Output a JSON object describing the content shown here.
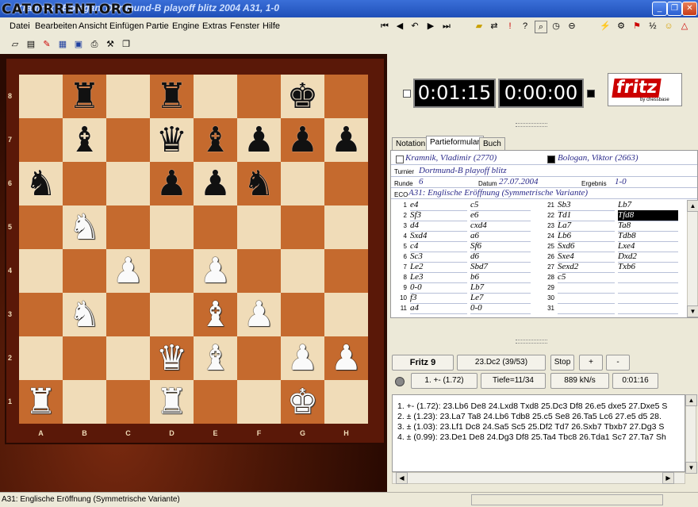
{
  "window": {
    "watermark": "CATORRENT.ORG",
    "title": "Kramnik - Bologan, Dortmund-B playoff blitz 2004  A31, 1-0"
  },
  "menu": [
    "Datei",
    "Bearbeiten",
    "Ansicht",
    "Einfügen",
    "Partie",
    "Engine",
    "Extras",
    "Fenster",
    "Hilfe"
  ],
  "board": {
    "files": [
      "A",
      "B",
      "C",
      "D",
      "E",
      "F",
      "G",
      "H"
    ],
    "ranks": [
      "8",
      "7",
      "6",
      "5",
      "4",
      "3",
      "2",
      "1"
    ],
    "position": [
      [
        "",
        "bR",
        "",
        "bR",
        "",
        "",
        "bK",
        ""
      ],
      [
        "",
        "bB",
        "",
        "bQ",
        "bB",
        "bP",
        "bP",
        "bP"
      ],
      [
        "bN",
        "",
        "",
        "bP",
        "bP",
        "bN",
        "",
        ""
      ],
      [
        "",
        "wN",
        "",
        "",
        "",
        "",
        "",
        ""
      ],
      [
        "",
        "",
        "wP",
        "",
        "wP",
        "",
        "",
        ""
      ],
      [
        "",
        "wN",
        "",
        "",
        "wB",
        "wP",
        "",
        ""
      ],
      [
        "",
        "",
        "",
        "wQ",
        "wB",
        "",
        "wP",
        "wP"
      ],
      [
        "wR",
        "",
        "",
        "wR",
        "",
        "",
        "wK",
        ""
      ]
    ]
  },
  "clocks": {
    "white": "0:01:15",
    "black": "0:00:00"
  },
  "logo": {
    "text": "fritz",
    "sub": "by chessbase"
  },
  "tabs": [
    "Notation",
    "Partieformular",
    "Buch"
  ],
  "game": {
    "white": "Kramnik, Vladimir (2770)",
    "black": "Bologan, Viktor (2663)",
    "labels": {
      "tournament": "Turnier",
      "round": "Runde",
      "date": "Datum",
      "result": "Ergebnis",
      "eco": "ECO"
    },
    "tournament": "Dortmund-B playoff blitz",
    "round": "6",
    "date": "27.07.2004",
    "result": "1-0",
    "eco": "A31: Englische Eröffnung (Symmetrische Variante)"
  },
  "moves_left": [
    {
      "n": "1",
      "w": "e4",
      "b": "c5"
    },
    {
      "n": "2",
      "w": "Sf3",
      "b": "e6"
    },
    {
      "n": "3",
      "w": "d4",
      "b": "cxd4"
    },
    {
      "n": "4",
      "w": "Sxd4",
      "b": "a6"
    },
    {
      "n": "5",
      "w": "c4",
      "b": "Sf6"
    },
    {
      "n": "6",
      "w": "Sc3",
      "b": "d6"
    },
    {
      "n": "7",
      "w": "Le2",
      "b": "Sbd7"
    },
    {
      "n": "8",
      "w": "Le3",
      "b": "b6"
    },
    {
      "n": "9",
      "w": "0-0",
      "b": "Lb7"
    },
    {
      "n": "10",
      "w": "f3",
      "b": "Le7"
    },
    {
      "n": "11",
      "w": "a4",
      "b": "0-0"
    }
  ],
  "moves_right": [
    {
      "n": "21",
      "w": "Sb3",
      "b": "Lb7"
    },
    {
      "n": "22",
      "w": "Td1",
      "b": "Tfd8"
    },
    {
      "n": "23",
      "w": "La7",
      "b": "Ta8"
    },
    {
      "n": "24",
      "w": "Lb6",
      "b": "Tdb8"
    },
    {
      "n": "25",
      "w": "Sxd6",
      "b": "Lxe4"
    },
    {
      "n": "26",
      "w": "Sxe4",
      "b": "Dxd2"
    },
    {
      "n": "27",
      "w": "Sexd2",
      "b": "Txb6"
    },
    {
      "n": "28",
      "w": "c5",
      "b": ""
    },
    {
      "n": "29",
      "w": "",
      "b": ""
    },
    {
      "n": "30",
      "w": "",
      "b": ""
    },
    {
      "n": "31",
      "w": "",
      "b": ""
    }
  ],
  "engine": {
    "name": "Fritz 9",
    "current_move": "23.Dc2 (39/53)",
    "stop": "Stop",
    "plus": "+",
    "minus": "-",
    "eval": "1. +- (1.72)",
    "depth": "Tiefe=11/34",
    "speed": "889 kN/s",
    "time": "0:01:16",
    "lines": [
      "1. +- (1.72): 23.Lb6 De8 24.Lxd8 Txd8 25.Dc3 Df8 26.e5 dxe5 27.Dxe5 S",
      "2. ± (1.23): 23.La7 Ta8 24.Lb6 Tdb8 25.c5 Se8 26.Ta5 Lc6 27.e5 d5 28.",
      "3. ± (1.03): 23.Lf1 Dc8 24.Sa5 Sc5 25.Df2 Td7 26.Sxb7 Tbxb7 27.Dg3 S",
      "4. ± (0.99): 23.De1 De8 24.Dg3 Df8 25.Ta4 Tbc8 26.Tda1 Sc7 27.Ta7 Sh"
    ]
  },
  "status": {
    "text": "A31: Englische Eröffnung (Symmetrische Variante)"
  },
  "colors": {
    "board_light": "#f0dcb8",
    "board_dark": "#c56a2e",
    "frame": "#3c1207"
  }
}
